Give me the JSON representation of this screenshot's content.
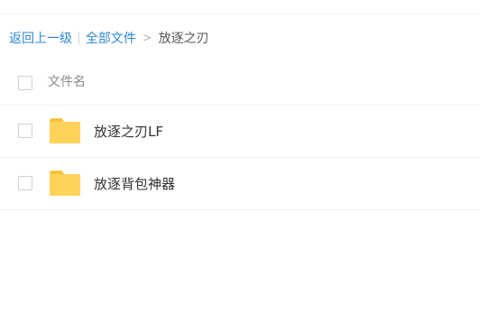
{
  "breadcrumb": {
    "back": "返回上一级",
    "pipe": "|",
    "all_files": "全部文件",
    "arrow": ">",
    "current": "放逐之刃"
  },
  "list": {
    "header": {
      "name_column": "文件名"
    },
    "items": [
      {
        "name": "放逐之刃LF",
        "icon": "folder-icon"
      },
      {
        "name": "放逐背包神器",
        "icon": "folder-icon"
      }
    ]
  },
  "colors": {
    "link": "#2f88d6",
    "folder": "#ffd35a",
    "folder_tab": "#f6c33e"
  }
}
